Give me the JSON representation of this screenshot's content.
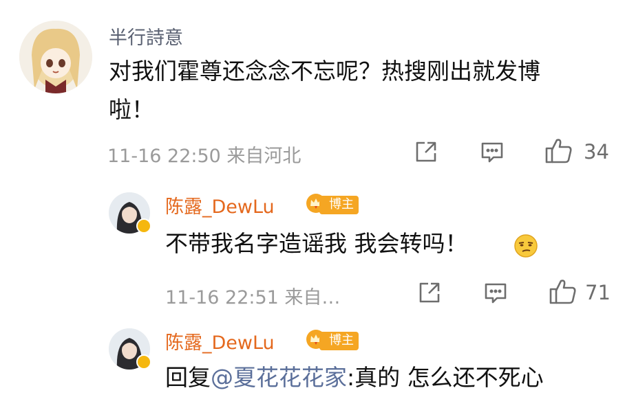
{
  "comment1": {
    "username": "半行詩意",
    "text_line1": "对我们霍尊还念念不忘呢？热搜刚出就发博",
    "text_line2": "啦！",
    "meta": "11-16 22:50 来自河北",
    "likes": "34"
  },
  "reply1": {
    "username": "陈露_DewLu",
    "badge": "博主",
    "text": "不带我名字造谣我 我会转吗！",
    "meta": "11-16 22:51 来自…",
    "likes": "71"
  },
  "reply2": {
    "username": "陈露_DewLu",
    "badge": "博主",
    "text_prefix": "回复",
    "mention": "@夏花花花家",
    "text_suffix": ":真的 怎么还不死心"
  },
  "colors": {
    "username": "#5a6172",
    "blogger_name": "#e4681d",
    "badge": "#f5a623",
    "meta": "#9a9a9a",
    "mention": "#5b6f9a"
  },
  "icons": [
    "share-icon",
    "comment-icon",
    "like-icon",
    "crown-icon",
    "verified-icon",
    "smirk-emoji-icon"
  ]
}
